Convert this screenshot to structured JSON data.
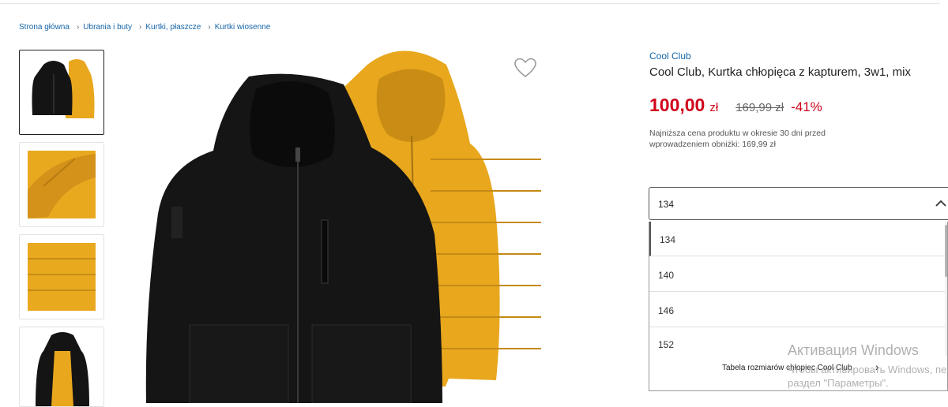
{
  "breadcrumb": [
    "Strona główna",
    "Ubrania i buty",
    "Kurtki, płaszcze",
    "Kurtki wiosenne"
  ],
  "product": {
    "brand": "Cool Club",
    "title": "Cool Club, Kurtka chłopięca z kapturem, 3w1, mix",
    "price": "100,00",
    "currency": "zł",
    "old_price": "169,99 zł",
    "discount": "-41%",
    "lowest_price_note": "Najniższa cena produktu w okresie 30 dni przed wprowadzeniem obniżki: 169,99 zł"
  },
  "size_select": {
    "selected": "134",
    "options": [
      "134",
      "140",
      "146",
      "152"
    ],
    "size_table_label": "Tabela rozmiarów chłopiec Cool Club"
  },
  "thumbnails": [
    "black-and-yellow-jackets",
    "yellow-jacket-hood-detail",
    "yellow-jacket-sleeve-detail",
    "black-jacket-yellow-lining"
  ],
  "watermark": {
    "title": "Активация Windows",
    "line1": "Чтобы активировать Windows, перейдите в",
    "line2": "раздел \"Параметры\"."
  },
  "colors": {
    "link": "#1565a8",
    "price": "#d0021b",
    "jacket_yellow": "#e8a71d",
    "jacket_black": "#141414"
  }
}
